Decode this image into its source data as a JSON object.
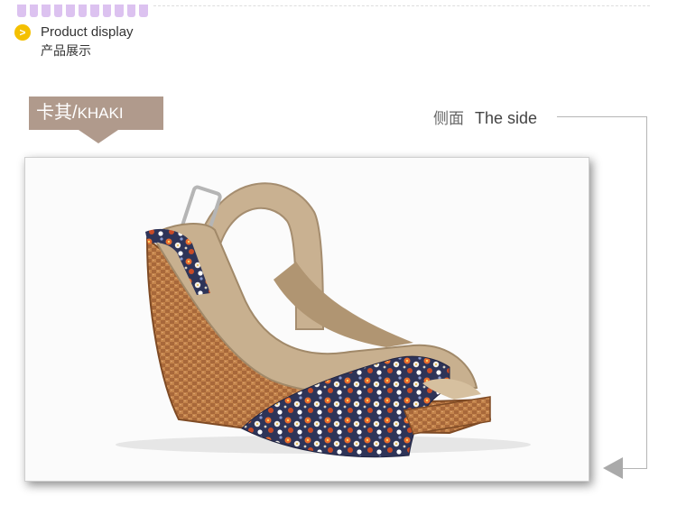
{
  "section": {
    "icon": "chevron-right-icon",
    "icon_glyph": ">",
    "title_en": "Product display",
    "title_cn": "产品展示"
  },
  "color_tag": {
    "cn": "卡其/",
    "en": "KHAKI"
  },
  "view": {
    "cn": "侧面",
    "en": "The side"
  },
  "photo": {
    "subject": "khaki floral peep-toe wedge sandal, side view"
  },
  "colors": {
    "accent_yellow": "#f4c000",
    "tag_bg": "#b09a8c",
    "top_dots": "#dcc2f0",
    "guide_line": "#b5b5b5"
  }
}
